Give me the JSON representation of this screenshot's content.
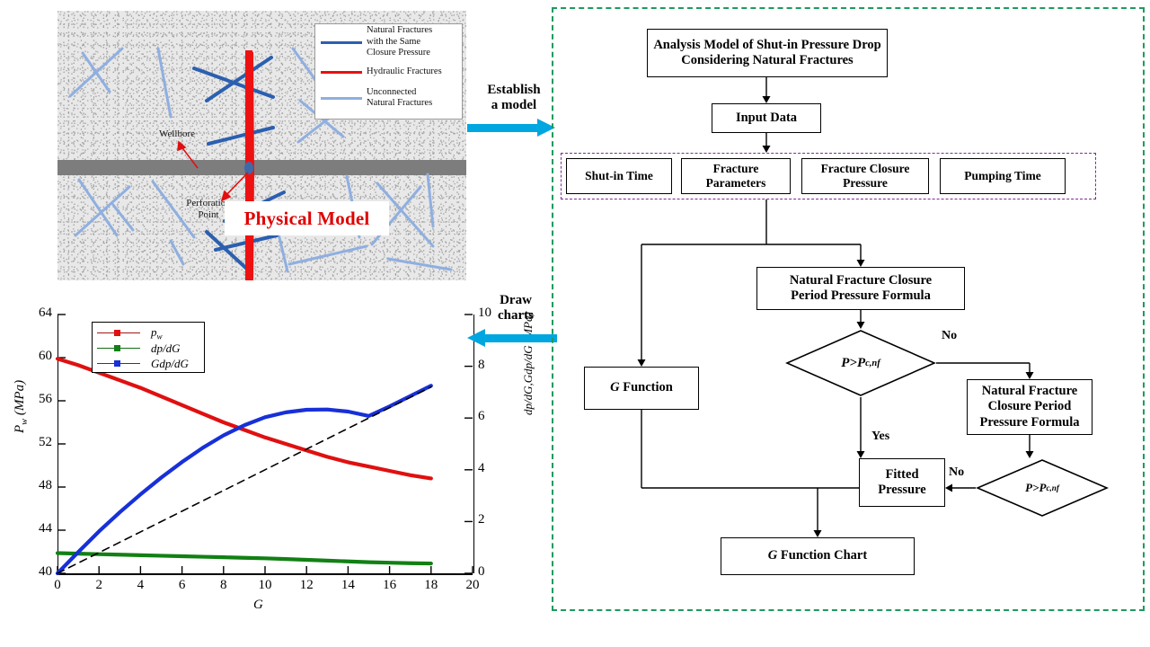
{
  "physical_model": {
    "title": "Physical Model",
    "annotations": [
      {
        "name": "wellbore",
        "text": "Wellbore"
      },
      {
        "name": "perforation-point",
        "text": "Perforation\nPoint"
      }
    ],
    "legend": [
      {
        "label": "Natural Fractures\nwith the Same\nClosure Pressure",
        "color": "#2b5fb0",
        "thickness": 3
      },
      {
        "label": "Hydraulic Fractures",
        "color": "#e81010",
        "thickness": 3
      },
      {
        "label": "Unconnected\nNatural Fractures",
        "color": "#8fafe0",
        "thickness": 3
      }
    ],
    "colors": {
      "hydraulic_fracture": "#ee1111",
      "connected_natural_fracture": "#2b5fb0",
      "unconnected_natural_fracture": "#8fafe0",
      "layer_band": "#7d7d7d",
      "title_text": "#e00000"
    }
  },
  "arrows": [
    {
      "name": "establish-a-model",
      "label": "Establish\na model",
      "direction": "right",
      "color": "#00a6e0"
    },
    {
      "name": "draw-charts",
      "label": "Draw\ncharts",
      "direction": "left",
      "color": "#00a6e0"
    }
  ],
  "chart_data": {
    "type": "line",
    "title": "",
    "xlabel": "G",
    "ylabel": "P_w (MPa)",
    "y2label": "dp/dG,Gdp/dG (MPa)",
    "xlim": [
      0,
      20
    ],
    "ylim": [
      40,
      64
    ],
    "y2lim": [
      0,
      10
    ],
    "xticks": [
      0,
      2,
      4,
      6,
      8,
      10,
      12,
      14,
      16,
      18,
      20
    ],
    "yticks": [
      40,
      44,
      48,
      52,
      56,
      60,
      64
    ],
    "y2ticks": [
      0,
      2,
      4,
      6,
      8,
      10
    ],
    "grid": false,
    "legend_position": "top-left",
    "x": [
      0,
      1,
      2,
      3,
      4,
      5,
      6,
      7,
      8,
      9,
      10,
      11,
      12,
      13,
      14,
      15,
      16,
      17,
      18
    ],
    "series": [
      {
        "name": "p_w",
        "label": "pw",
        "color": "#e01010",
        "axis": "left",
        "values": [
          59.9,
          59.3,
          58.6,
          57.9,
          57.2,
          56.4,
          55.6,
          54.8,
          54.0,
          53.3,
          52.6,
          52.0,
          51.4,
          50.8,
          50.3,
          49.9,
          49.5,
          49.1,
          48.8
        ]
      },
      {
        "name": "dp/dG",
        "label": "dp/dG",
        "color": "#128014",
        "axis": "right",
        "values": [
          0.78,
          0.76,
          0.74,
          0.72,
          0.7,
          0.68,
          0.66,
          0.64,
          0.62,
          0.6,
          0.58,
          0.55,
          0.52,
          0.49,
          0.46,
          0.43,
          0.41,
          0.39,
          0.38
        ]
      },
      {
        "name": "Gdp/dG",
        "label": "Gdp/dG",
        "color": "#1730d8",
        "axis": "right",
        "values": [
          0.0,
          0.82,
          1.62,
          2.36,
          3.05,
          3.7,
          4.3,
          4.85,
          5.33,
          5.72,
          6.03,
          6.22,
          6.32,
          6.33,
          6.25,
          6.08,
          6.45,
          6.85,
          7.25
        ]
      },
      {
        "name": "tangent-line",
        "label": "",
        "color": "#000000",
        "axis": "right",
        "style": "dashed",
        "values": [
          0.0,
          0.4,
          0.8,
          1.2,
          1.6,
          2.0,
          2.4,
          2.8,
          3.2,
          3.6,
          4.0,
          4.4,
          4.8,
          5.2,
          5.6,
          6.0,
          6.4,
          6.8,
          7.2
        ]
      }
    ]
  },
  "flowchart": {
    "border_color": "#1d9b5e",
    "group_border_color": "#7b2d8e",
    "nodes": [
      {
        "id": "model",
        "label": "Analysis Model of Shut-in Pressure Drop\nConsidering Natural Fractures",
        "shape": "rect"
      },
      {
        "id": "input",
        "label": "Input  Data",
        "shape": "rect"
      },
      {
        "id": "shutin",
        "label": "Shut-in Time",
        "shape": "rect"
      },
      {
        "id": "fracparams",
        "label": "Fracture\nParameters",
        "shape": "rect"
      },
      {
        "id": "closurepressure",
        "label": "Fracture Closure\nPressure",
        "shape": "rect"
      },
      {
        "id": "pumping",
        "label": "Pumping Time",
        "shape": "rect"
      },
      {
        "id": "nf-formula-1",
        "label": "Natural Fracture Closure\nPeriod Pressure Formula",
        "shape": "rect"
      },
      {
        "id": "decision-1",
        "label": "P>Pc,nf",
        "shape": "diamond"
      },
      {
        "id": "gfunction",
        "label": "G Function",
        "shape": "rect"
      },
      {
        "id": "nf-formula-2",
        "label": "Natural Fracture\nClosure Period\nPressure Formula",
        "shape": "rect"
      },
      {
        "id": "decision-2",
        "label": "P>Pc,nf",
        "shape": "diamond"
      },
      {
        "id": "fitted",
        "label": "Fitted\nPressure",
        "shape": "rect"
      },
      {
        "id": "gchart",
        "label": "G Function Chart",
        "shape": "rect"
      }
    ],
    "edge_labels": [
      {
        "id": "no-1",
        "text": "No"
      },
      {
        "id": "yes-1",
        "text": "Yes"
      },
      {
        "id": "no-2",
        "text": "No"
      }
    ]
  }
}
